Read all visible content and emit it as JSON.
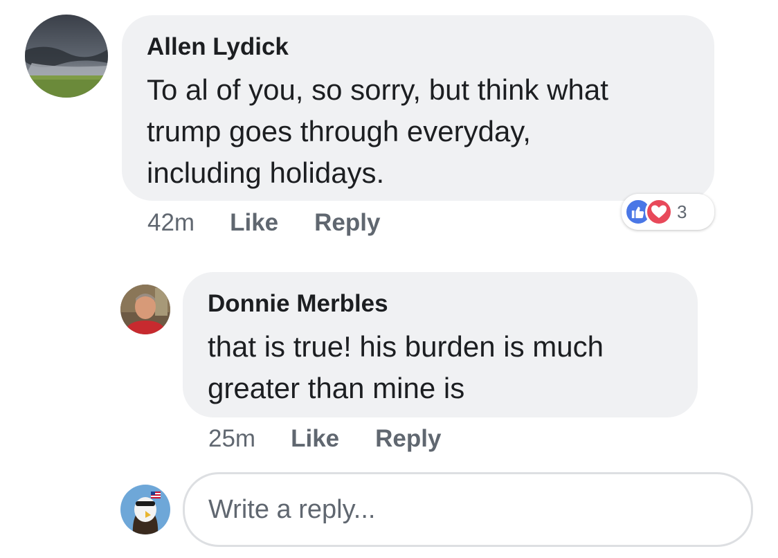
{
  "comments": [
    {
      "author": "Allen Lydick",
      "text_lines": [
        "To al of you, so sorry, but think what",
        "trump goes through everyday,",
        "including holidays."
      ],
      "time": "42m",
      "like_label": "Like",
      "reply_label": "Reply",
      "reaction_count": "3"
    },
    {
      "author": "Donnie Merbles",
      "text_lines": [
        "that is true! his burden is much",
        "greater than mine is"
      ],
      "time": "25m",
      "like_label": "Like",
      "reply_label": "Reply"
    }
  ],
  "reply_box": {
    "placeholder": "Write a reply..."
  },
  "colors": {
    "bubble": "#f0f1f3",
    "like_blue": "#4a77e6",
    "love_red": "#e8495a",
    "meta_gray": "#606770"
  },
  "icons": {
    "like": "thumbs-up-icon",
    "love": "heart-icon"
  }
}
